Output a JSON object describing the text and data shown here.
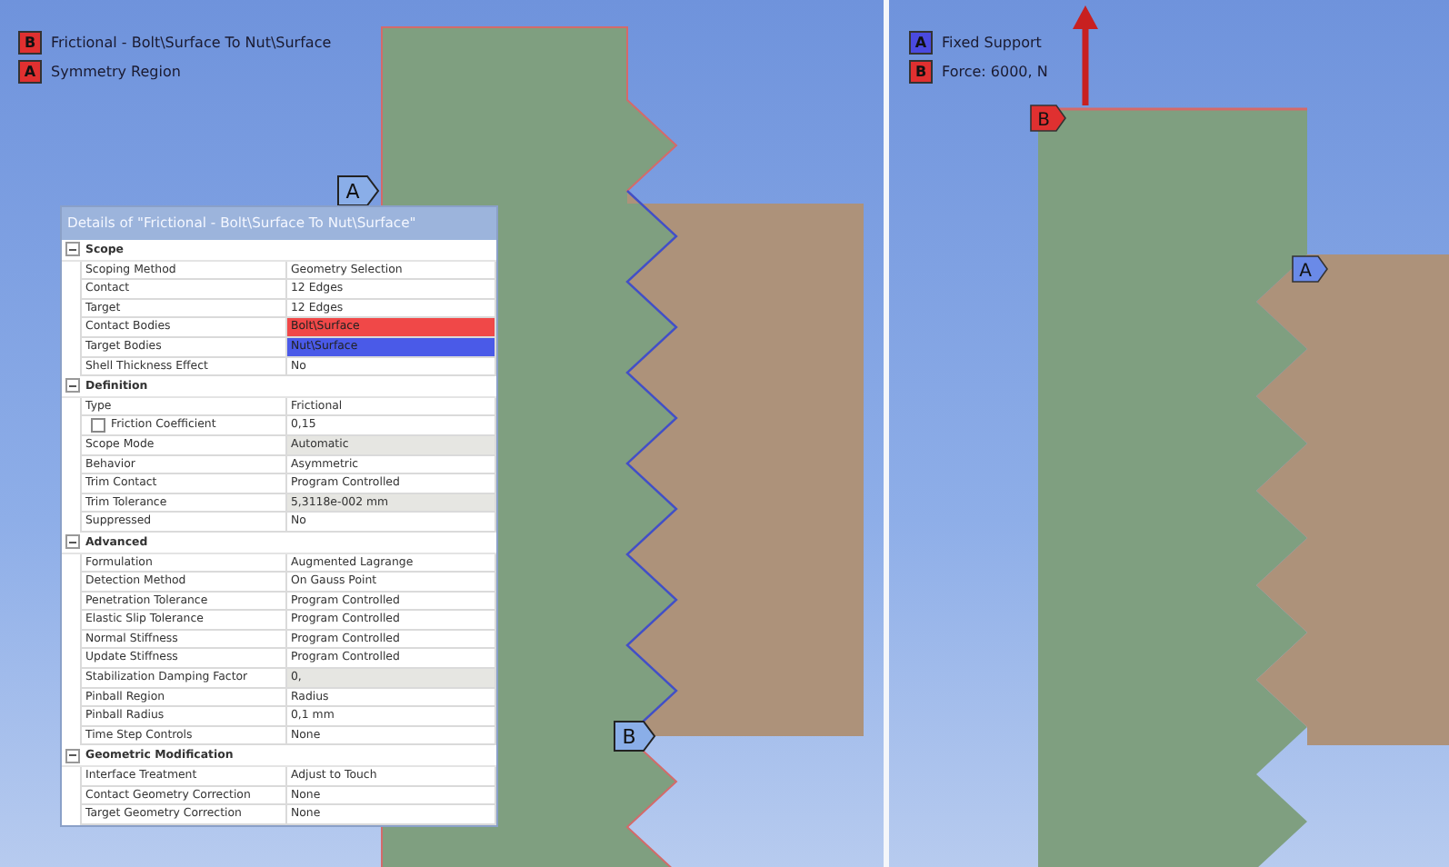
{
  "left_view": {
    "legend": [
      {
        "letter": "B",
        "label": "Frictional - Bolt\\Surface To Nut\\Surface",
        "color": "#e03030"
      },
      {
        "letter": "A",
        "label": "Symmetry Region",
        "color": "#e03030"
      }
    ],
    "tags": [
      {
        "letter": "A"
      },
      {
        "letter": "B"
      }
    ]
  },
  "details": {
    "title": "Details of \"Frictional - Bolt\\Surface To Nut\\Surface\"",
    "rows": [
      {
        "kind": "section",
        "label": "Scope",
        "expanded": true
      },
      {
        "kind": "row",
        "label": "Scoping Method",
        "value": "Geometry Selection"
      },
      {
        "kind": "row",
        "label": "Contact",
        "value": "12 Edges"
      },
      {
        "kind": "row",
        "label": "Target",
        "value": "12 Edges"
      },
      {
        "kind": "row",
        "label": "Contact Bodies",
        "value": "Bolt\\Surface",
        "color": "#f04848"
      },
      {
        "kind": "row",
        "label": "Target Bodies",
        "value": "Nut\\Surface",
        "color": "#4a5ae8"
      },
      {
        "kind": "row",
        "label": "Shell Thickness Effect",
        "value": "No"
      },
      {
        "kind": "section",
        "label": "Definition",
        "expanded": true
      },
      {
        "kind": "row",
        "label": "Type",
        "value": "Frictional"
      },
      {
        "kind": "check",
        "label": "Friction Coefficient",
        "value": "0,15",
        "checked": false
      },
      {
        "kind": "row",
        "label": "Scope Mode",
        "value": "Automatic",
        "shaded": true
      },
      {
        "kind": "row",
        "label": "Behavior",
        "value": "Asymmetric"
      },
      {
        "kind": "row",
        "label": "Trim Contact",
        "value": "Program Controlled"
      },
      {
        "kind": "row",
        "label": "Trim Tolerance",
        "value": "5,3118e-002 mm",
        "shaded": true
      },
      {
        "kind": "row",
        "label": "Suppressed",
        "value": "No"
      },
      {
        "kind": "section",
        "label": "Advanced",
        "expanded": true
      },
      {
        "kind": "row",
        "label": "Formulation",
        "value": "Augmented Lagrange"
      },
      {
        "kind": "row",
        "label": "Detection Method",
        "value": "On Gauss Point"
      },
      {
        "kind": "row",
        "label": "Penetration Tolerance",
        "value": "Program Controlled"
      },
      {
        "kind": "row",
        "label": "Elastic Slip Tolerance",
        "value": "Program Controlled"
      },
      {
        "kind": "row",
        "label": "Normal Stiffness",
        "value": "Program Controlled"
      },
      {
        "kind": "row",
        "label": "Update Stiffness",
        "value": "Program Controlled"
      },
      {
        "kind": "row",
        "label": "Stabilization Damping Factor",
        "value": "0,",
        "shaded": true
      },
      {
        "kind": "row",
        "label": "Pinball Region",
        "value": "Radius"
      },
      {
        "kind": "row",
        "label": "Pinball Radius",
        "value": "0,1 mm"
      },
      {
        "kind": "row",
        "label": "Time Step Controls",
        "value": "None"
      },
      {
        "kind": "section",
        "label": "Geometric Modification",
        "expanded": true
      },
      {
        "kind": "row",
        "label": "Interface Treatment",
        "value": "Adjust to Touch"
      },
      {
        "kind": "row",
        "label": "Contact Geometry Correction",
        "value": "None"
      },
      {
        "kind": "row",
        "label": "Target Geometry Correction",
        "value": "None"
      }
    ]
  },
  "right_view": {
    "legend": [
      {
        "letter": "A",
        "label": "Fixed Support",
        "color": "#4a4ae0"
      },
      {
        "letter": "B",
        "label": "Force: 6000, N",
        "color": "#e03030"
      }
    ],
    "tags": [
      {
        "letter": "B"
      },
      {
        "letter": "A"
      }
    ]
  }
}
